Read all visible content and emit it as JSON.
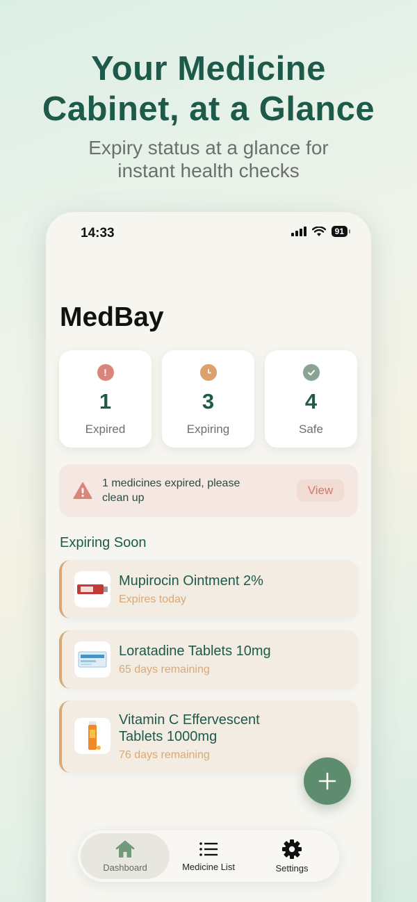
{
  "promo": {
    "title_line1": "Your Medicine",
    "title_line2": "Cabinet, at a Glance",
    "subtitle_line1": "Expiry status at a glance for",
    "subtitle_line2": "instant health checks"
  },
  "status_bar": {
    "time": "14:33",
    "battery": "91"
  },
  "app": {
    "title": "MedBay"
  },
  "stats": [
    {
      "value": "1",
      "label": "Expired",
      "icon": "exclamation-icon",
      "color": "#d9857a"
    },
    {
      "value": "3",
      "label": "Expiring",
      "icon": "clock-icon",
      "color": "#dba16f"
    },
    {
      "value": "4",
      "label": "Safe",
      "icon": "check-icon",
      "color": "#8aa392"
    }
  ],
  "alert": {
    "line1": "1 medicines expired, please",
    "line2": "clean up",
    "button_label": "View",
    "icon": "warning-icon"
  },
  "expiring_section": {
    "title": "Expiring Soon",
    "items": [
      {
        "name": "Mupirocin Ointment 2%",
        "status": "Expires today"
      },
      {
        "name": "Loratadine Tablets 10mg",
        "status": "65 days remaining"
      },
      {
        "name_line1": "Vitamin C Effervescent",
        "name_line2": "Tablets 1000mg",
        "status": "76 days remaining"
      }
    ]
  },
  "fab": {
    "icon": "plus-icon"
  },
  "tabbar": {
    "tabs": [
      {
        "label": "Dashboard",
        "icon": "home-icon",
        "active": true
      },
      {
        "label": "Medicine List",
        "icon": "list-icon",
        "active": false
      },
      {
        "label": "Settings",
        "icon": "gear-icon",
        "active": false
      }
    ]
  },
  "colors": {
    "brand": "#1d5a4a",
    "accent_green": "#5e8c6e",
    "expired": "#d9857a",
    "expiring": "#d9a875",
    "safe": "#8aa392"
  }
}
